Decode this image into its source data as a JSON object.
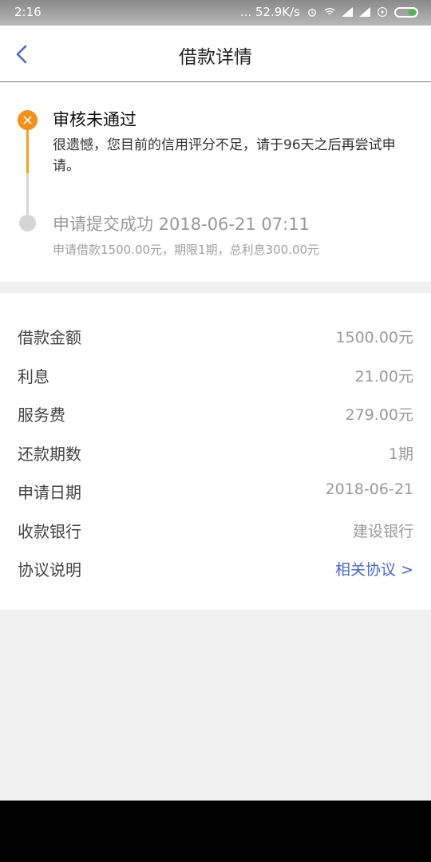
{
  "status_bar": {
    "time": "2:16",
    "net_speed": "... 52.9K/s"
  },
  "header": {
    "title": "借款详情"
  },
  "timeline": {
    "steps": [
      {
        "title": "审核未通过",
        "desc": "很遗憾，您目前的信用评分不足，请于96天之后再尝试申请。",
        "status": "failed",
        "color": "#f6901b"
      },
      {
        "title": "申请提交成功 2018-06-21 07:11",
        "desc": "申请借款1500.00元，期限1期，总利息300.00元",
        "status": "done",
        "color": "#d6d6d6"
      }
    ]
  },
  "details": {
    "rows": [
      {
        "label": "借款金额",
        "value": "1500.00元"
      },
      {
        "label": "利息",
        "value": "21.00元"
      },
      {
        "label": "服务费",
        "value": "279.00元"
      },
      {
        "label": "还款期数",
        "value": "1期"
      },
      {
        "label": "申请日期",
        "value": "2018-06-21"
      },
      {
        "label": "收款银行",
        "value": "建设银行"
      },
      {
        "label": "协议说明",
        "value": "相关协议 >"
      }
    ]
  },
  "colors": {
    "accent_link": "#4a67c8",
    "fail_orange": "#f6901b"
  }
}
